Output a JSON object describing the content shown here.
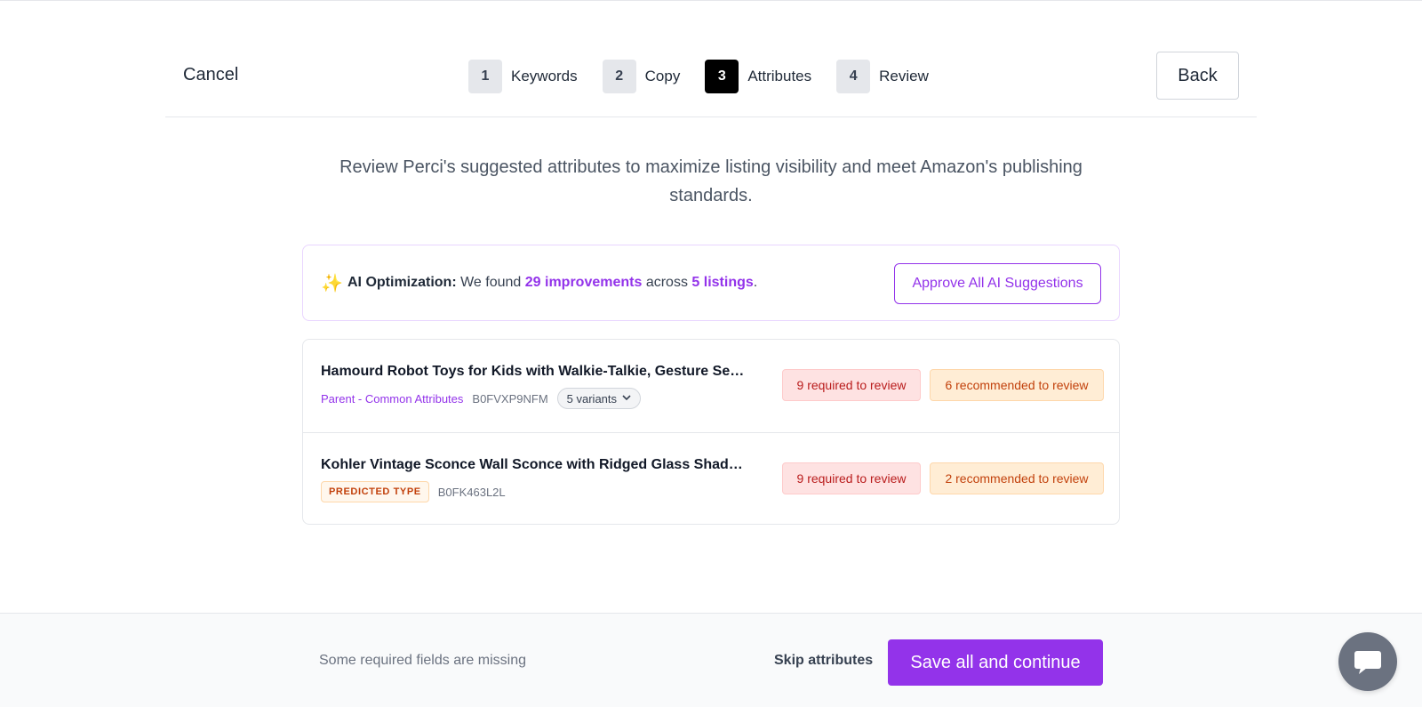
{
  "header": {
    "cancel_label": "Cancel",
    "back_label": "Back",
    "steps": [
      {
        "number": "1",
        "label": "Keywords",
        "active": false
      },
      {
        "number": "2",
        "label": "Copy",
        "active": false
      },
      {
        "number": "3",
        "label": "Attributes",
        "active": true
      },
      {
        "number": "4",
        "label": "Review",
        "active": false
      }
    ]
  },
  "intro": {
    "text": "Review Perci's suggested attributes to maximize listing visibility and meet Amazon's publishing standards."
  },
  "ai_banner": {
    "icon": "sparkles-icon",
    "label": "AI Optimization:",
    "text_1": "We found",
    "improvements": "29 improvements",
    "text_2": "across",
    "listings": "5 listings",
    "text_3": ".",
    "approve_label": "Approve All AI Suggestions"
  },
  "listings": [
    {
      "title": "Hamourd Robot Toys for Kids with Walkie-Talkie, Gesture Sens...",
      "parent_label": "Parent - Common Attributes",
      "asin": "B0FVXP9NFM",
      "variants_label": "5 variants",
      "required": "9 required to review",
      "recommended": "6 recommended to review"
    },
    {
      "title": "Kohler Vintage Sconce Wall Sconce with Ridged Glass Shades &...",
      "type_badge": "PREDICTED TYPE",
      "asin": "B0FK463L2L",
      "required": "9 required to review",
      "recommended": "2 recommended to review"
    }
  ],
  "footer": {
    "missing_text": "Some required fields are missing",
    "skip_label": "Skip attributes",
    "save_label": "Save all and continue",
    "chat_icon": "chat-icon"
  },
  "colors": {
    "accent": "#9333ea",
    "required_bg": "#fee2e2",
    "recommended_bg": "#ffedd5",
    "active_step": "#000000"
  }
}
